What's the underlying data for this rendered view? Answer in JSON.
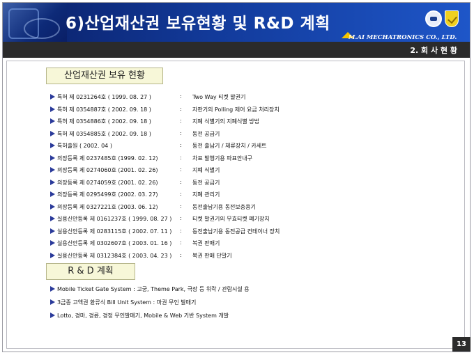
{
  "header": {
    "title": "6)산업재산권 보유현황 및 R&D 계획",
    "company": "M.AI MECHATRONICS CO., LTD."
  },
  "section_label": "2. 회 사 현 황",
  "ip_section": {
    "heading": "산업재산권 보유 현황",
    "items": [
      {
        "name": "특허 제 0231264호 ( 1999. 08. 27 )",
        "desc": "Two Way 티켓 발권기"
      },
      {
        "name": "특허 제 0354887호 ( 2002. 09. 18 )",
        "desc": "자판기의 Polling 제어 요금 처리장치"
      },
      {
        "name": "특허 제 0354886호 ( 2002. 09. 18 )",
        "desc": "지폐 식별기의 지폐식별 방법"
      },
      {
        "name": "특허 제 0354885호 ( 2002. 09. 18 )",
        "desc": "동전 공급기"
      },
      {
        "name": "특허출원 ( 2002. 04 )",
        "desc": "동전 출납기 / 체류장치 / 카세트"
      },
      {
        "name": "의장등록 제 0237485호 (1999. 02. 12)",
        "desc": "차표 발행기용 파표안내구"
      },
      {
        "name": "의장등록 제 0274060호 (2001. 02. 26)",
        "desc": "지폐 식별기"
      },
      {
        "name": "의장등록 제 0274059호 (2001. 02. 26)",
        "desc": "동전 공급기"
      },
      {
        "name": "의장등록 제 0295499호 (2002. 03. 27)",
        "desc": "지폐 관리기"
      },
      {
        "name": "의장등록 제 0327221호 (2003. 06. 12)",
        "desc": "동전출납기용 동전보충용기"
      },
      {
        "name": "실용신안등록 제 0161237호 ( 1999. 08. 27 )",
        "desc": "티켓 발권기의 무효티켓 폐기장치"
      },
      {
        "name": "실용신안등록 제 0283115호 ( 2002. 07. 11 )",
        "desc": "동전출납기용 동전공급 컨테이너 장치"
      },
      {
        "name": "실용신안등록 제 0302607호 ( 2003. 01. 16 )",
        "desc": "복권 판매기"
      },
      {
        "name": "실용신안등록 제 0312384호 ( 2003. 04. 23 )",
        "desc": "복권 판매 단말기"
      }
    ]
  },
  "rd_section": {
    "heading": "R & D  계획",
    "items": [
      "Mobile Ticket Gate System : 고궁, Theme Park, 극장 등 위락 / 관람시설 용",
      "3금종 고액권 환류식 Bill Unit System : 마권 무인 발매기",
      "Lotto, 경마, 경륜, 경정 무인발매기, Mobile & Web 기반 System 개발"
    ]
  },
  "page_number": "13",
  "colon": ":"
}
